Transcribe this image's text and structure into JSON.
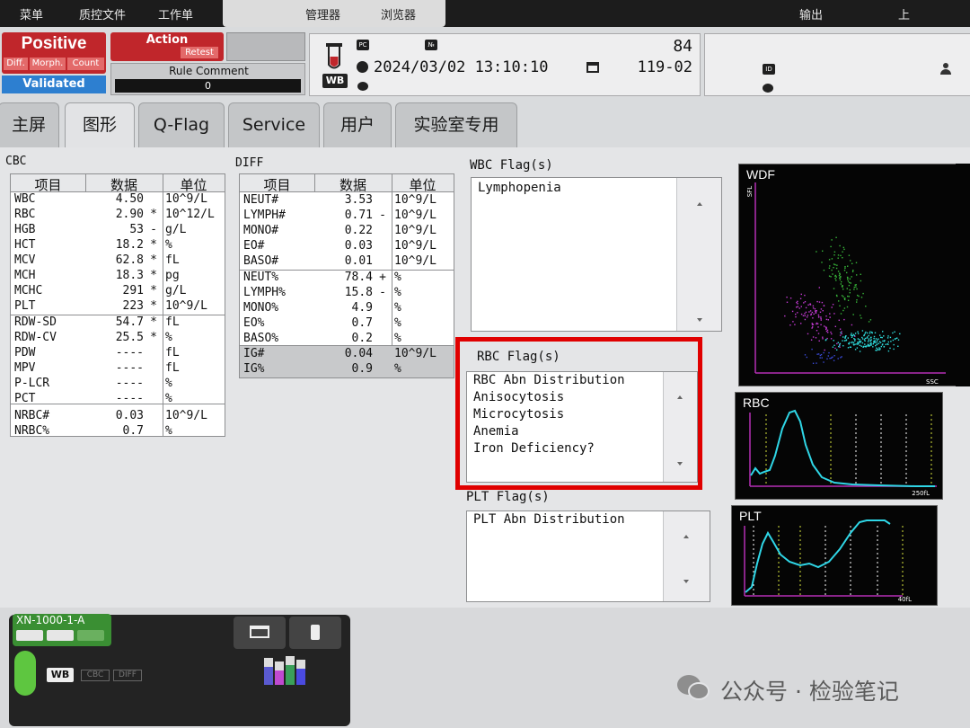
{
  "topbar": {
    "items": [
      "菜单",
      "质控文件",
      "工作单",
      "管理器",
      "浏览器"
    ],
    "right_items": [
      "输出",
      "上"
    ]
  },
  "status": {
    "positive": "Positive",
    "positive_subs": [
      "Diff.",
      "Morph.",
      "Count"
    ],
    "validated": "Validated",
    "action": "Action",
    "retest": "Retest",
    "rule_comment_label": "Rule Comment",
    "rule_comment_value": "0"
  },
  "sample": {
    "pc_icon": "PC",
    "no_icon": "№",
    "number": "84",
    "datetime": "2024/03/02 13:10:10",
    "rack": "119-02",
    "wb": "WB"
  },
  "patient": {
    "id_icon": "ID"
  },
  "tabs": [
    "主屏",
    "图形",
    "Q-Flag",
    "Service",
    "用户",
    "实验室专用"
  ],
  "active_tab": 1,
  "cbc": {
    "title": "CBC",
    "headers": [
      "项目",
      "数据",
      "单位"
    ],
    "rows": [
      [
        "WBC",
        "4.50",
        "",
        "10^9/L"
      ],
      [
        "RBC",
        "2.90",
        "*",
        "10^12/L"
      ],
      [
        "HGB",
        "53",
        "-",
        "g/L"
      ],
      [
        "HCT",
        "18.2",
        "*",
        "%"
      ],
      [
        "MCV",
        "62.8",
        "*",
        "fL"
      ],
      [
        "MCH",
        "18.3",
        "*",
        "pg"
      ],
      [
        "MCHC",
        "291",
        "*",
        "g/L"
      ],
      [
        "PLT",
        "223",
        "*",
        "10^9/L"
      ],
      [
        "RDW-SD",
        "54.7",
        "*",
        "fL"
      ],
      [
        "RDW-CV",
        "25.5",
        "*",
        "%"
      ],
      [
        "PDW",
        "----",
        "",
        "fL"
      ],
      [
        "MPV",
        "----",
        "",
        "fL"
      ],
      [
        "P-LCR",
        "----",
        "",
        "%"
      ],
      [
        "PCT",
        "----",
        "",
        "%"
      ],
      [
        "NRBC#",
        "0.03",
        "",
        "10^9/L"
      ],
      [
        "NRBC%",
        "0.7",
        "",
        "%"
      ]
    ]
  },
  "diff": {
    "title": "DIFF",
    "headers": [
      "项目",
      "数据",
      "单位"
    ],
    "rows": [
      [
        "NEUT#",
        "3.53",
        "",
        "10^9/L"
      ],
      [
        "LYMPH#",
        "0.71",
        "-",
        "10^9/L"
      ],
      [
        "MONO#",
        "0.22",
        "",
        "10^9/L"
      ],
      [
        "EO#",
        "0.03",
        "",
        "10^9/L"
      ],
      [
        "BASO#",
        "0.01",
        "",
        "10^9/L"
      ],
      [
        "NEUT%",
        "78.4",
        "+",
        "%"
      ],
      [
        "LYMPH%",
        "15.8",
        "-",
        "%"
      ],
      [
        "MONO%",
        "4.9",
        "",
        "%"
      ],
      [
        "EO%",
        "0.7",
        "",
        "%"
      ],
      [
        "BASO%",
        "0.2",
        "",
        "%"
      ],
      [
        "IG#",
        "0.04",
        "",
        "10^9/L"
      ],
      [
        "IG%",
        "0.9",
        "",
        "%"
      ]
    ]
  },
  "flags": {
    "wbc_title": "WBC Flag(s)",
    "wbc": [
      "Lymphopenia"
    ],
    "rbc_title": "RBC Flag(s)",
    "rbc": [
      "RBC Abn Distribution",
      "Anisocytosis",
      "Microcytosis",
      "Anemia",
      "Iron Deficiency?"
    ],
    "plt_title": "PLT Flag(s)",
    "plt": [
      "PLT Abn Distribution"
    ]
  },
  "graphs": {
    "wdf": {
      "title": "WDF",
      "y_axis": "SFL",
      "x_axis": "SSC"
    },
    "rbc": {
      "title": "RBC",
      "x_max": "250fL"
    },
    "plt": {
      "title": "PLT",
      "x_max": "40fL"
    }
  },
  "analyzer": {
    "name": "XN-1000-1-A",
    "mode": "WB",
    "modes": [
      "CBC",
      "DIFF"
    ]
  },
  "watermark": "公众号 · 检验笔记",
  "colors": {
    "positive_red": "#c0262b",
    "validated_blue": "#2d7fd0",
    "highlight_red": "#e00000",
    "curve_cyan": "#2fd6e6",
    "analyzer_green": "#3a8f33"
  }
}
